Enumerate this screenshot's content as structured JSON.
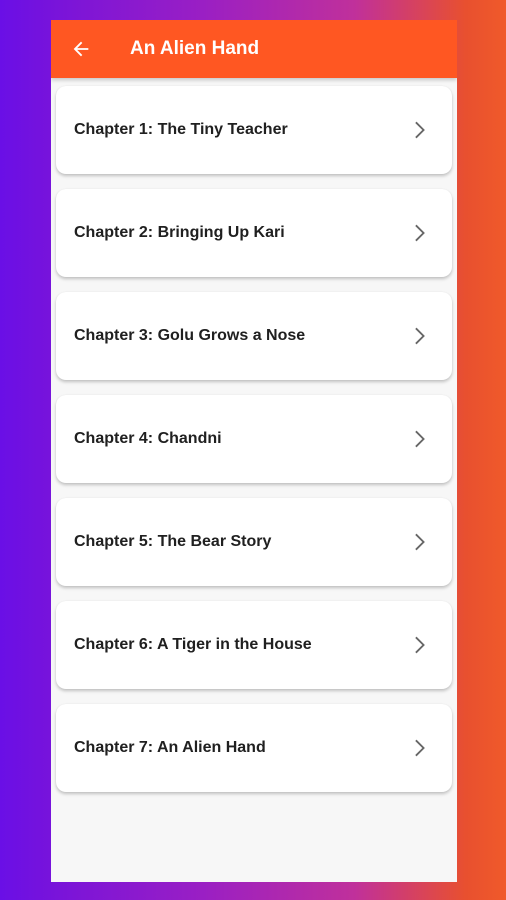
{
  "appbar": {
    "title": "An Alien Hand",
    "back_icon": "arrow-left-icon",
    "color": "#ff5722"
  },
  "chapters": [
    {
      "label": "Chapter 1: The Tiny Teacher"
    },
    {
      "label": "Chapter 2: Bringing Up Kari"
    },
    {
      "label": "Chapter 3: Golu Grows a Nose"
    },
    {
      "label": "Chapter 4: Chandni"
    },
    {
      "label": "Chapter 5: The Bear Story"
    },
    {
      "label": "Chapter 6: A Tiger in the House"
    },
    {
      "label": "Chapter 7: An Alien Hand"
    }
  ],
  "chevron_icon": "chevron-right-icon"
}
